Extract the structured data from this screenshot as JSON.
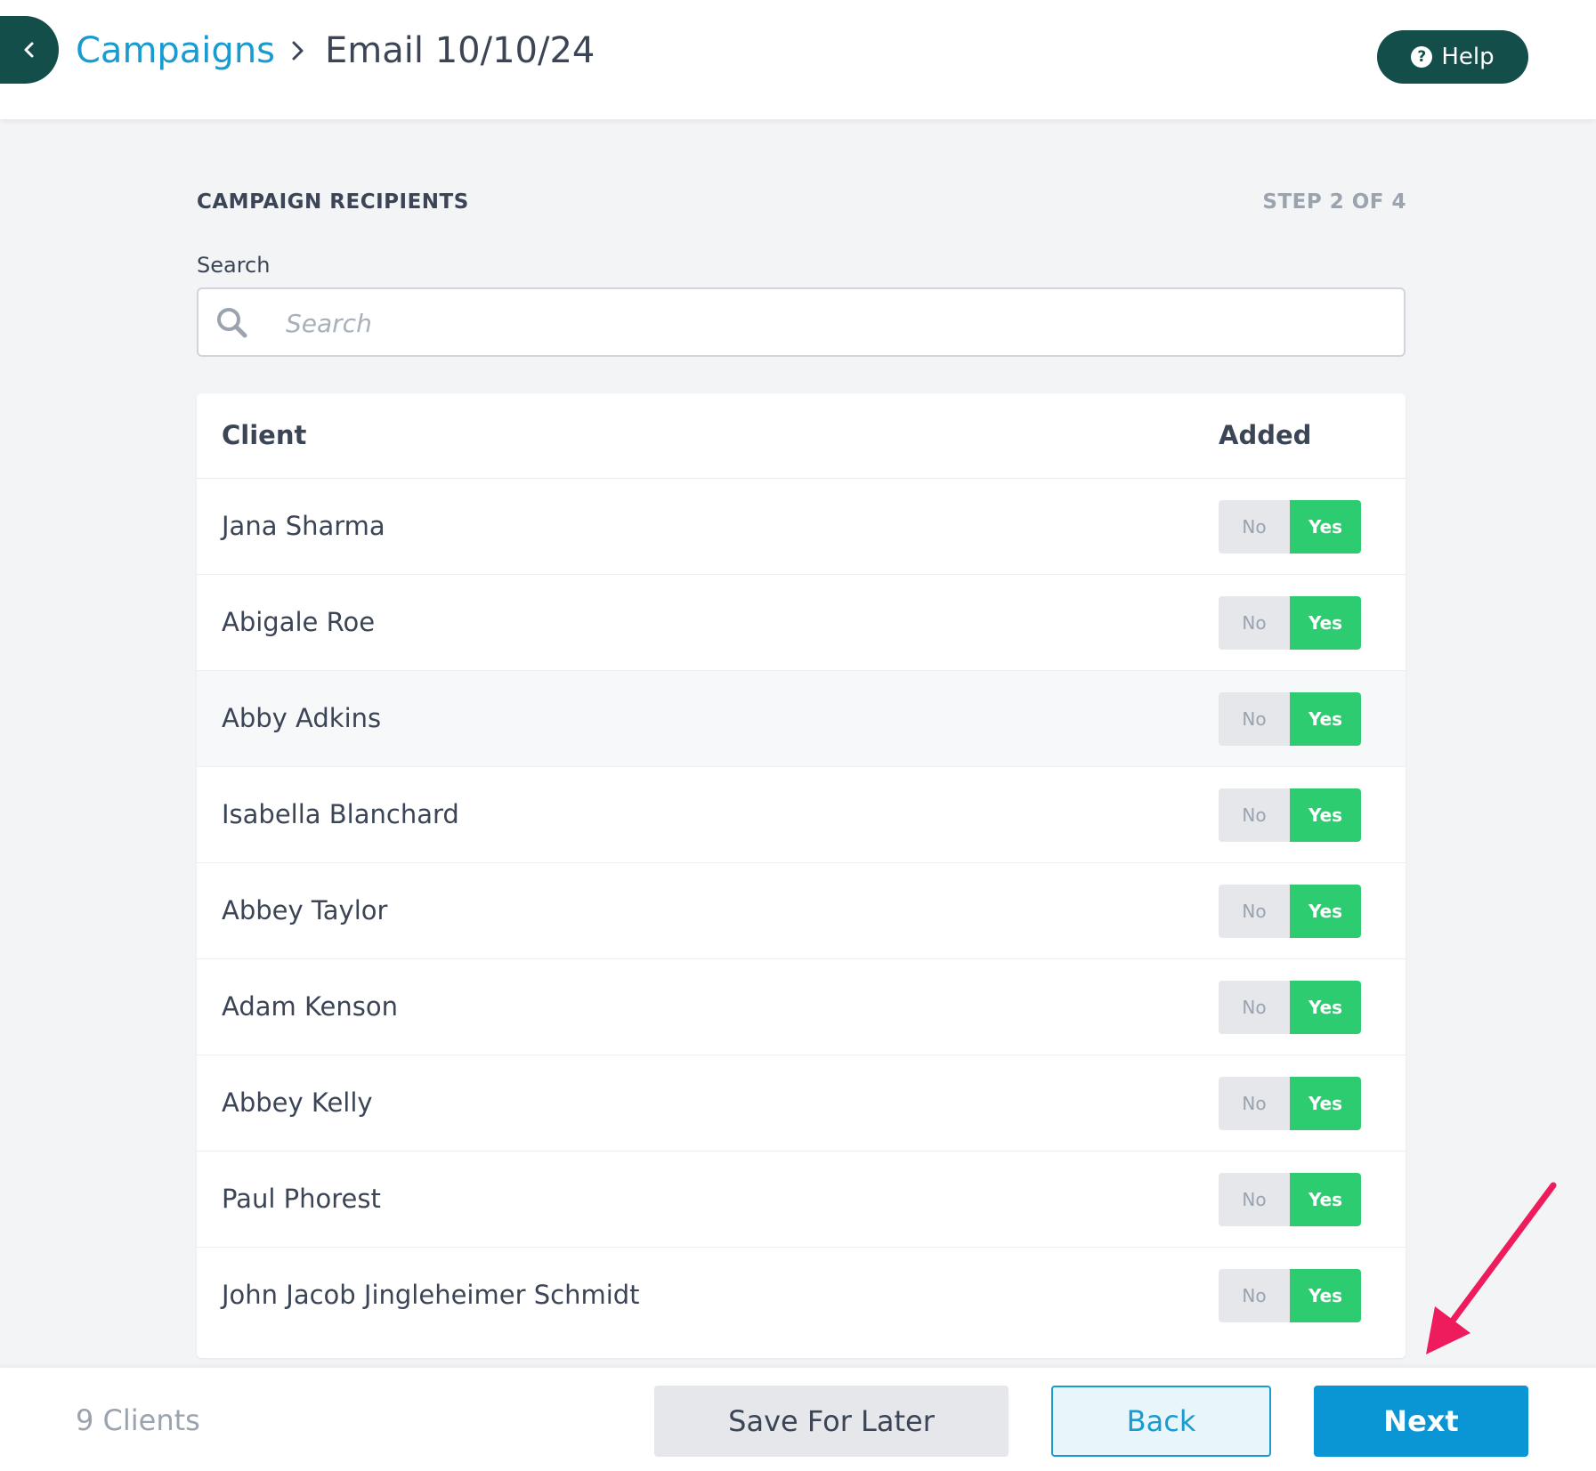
{
  "header": {
    "breadcrumb_parent": "Campaigns",
    "breadcrumb_current": "Email 10/10/24",
    "help_label": "Help"
  },
  "section": {
    "title": "CAMPAIGN RECIPIENTS",
    "step": "STEP 2 OF 4"
  },
  "search": {
    "label": "Search",
    "placeholder": "Search",
    "value": ""
  },
  "table": {
    "columns": {
      "client": "Client",
      "added": "Added"
    },
    "toggle_labels": {
      "no": "No",
      "yes": "Yes"
    },
    "rows": [
      {
        "name": "Jana Sharma",
        "added": "Yes"
      },
      {
        "name": "Abigale Roe",
        "added": "Yes"
      },
      {
        "name": "Abby Adkins",
        "added": "Yes"
      },
      {
        "name": "Isabella Blanchard",
        "added": "Yes"
      },
      {
        "name": "Abbey Taylor",
        "added": "Yes"
      },
      {
        "name": "Adam Kenson",
        "added": "Yes"
      },
      {
        "name": "Abbey Kelly",
        "added": "Yes"
      },
      {
        "name": "Paul Phorest",
        "added": "Yes"
      },
      {
        "name": "John Jacob Jingleheimer Schmidt",
        "added": "Yes"
      }
    ]
  },
  "footer": {
    "count_label": "9 Clients",
    "save_label": "Save For Later",
    "back_label": "Back",
    "next_label": "Next"
  },
  "colors": {
    "brand_dark": "#134e4a",
    "link_blue": "#1a9bd0",
    "primary_blue": "#0a96d4",
    "toggle_yes": "#2ecc71",
    "annotation": "#ee1c5c"
  }
}
